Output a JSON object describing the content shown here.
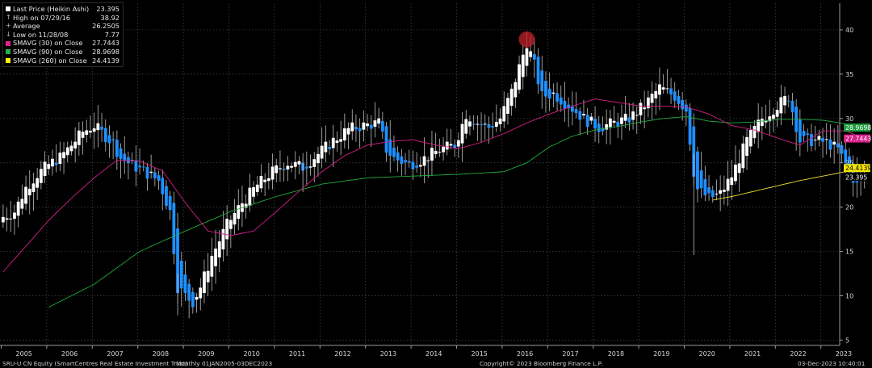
{
  "chart_data": {
    "type": "candlestick",
    "title": "SRU-U CN Equity (SmartCentres Real Estate Investment Trust)",
    "period": "Monthly 01JAN2005-03DEC2023",
    "ylim": [
      4.4,
      43
    ],
    "yticks": [
      5,
      10,
      15,
      20,
      25,
      30,
      35,
      40
    ],
    "x_year_labels": [
      "2005",
      "2006",
      "2007",
      "2008",
      "2009",
      "2010",
      "2011",
      "2012",
      "2013",
      "2014",
      "2015",
      "2016",
      "2017",
      "2018",
      "2019",
      "2020",
      "2021",
      "2022",
      "2023"
    ],
    "grid": true,
    "legend_position": "top-left",
    "candle_colors": {
      "up": "#ffffff",
      "down": "#1e90ff",
      "wick": "#bfbfbf"
    },
    "legend": [
      {
        "label": "Last Price (Heikin Ashi)",
        "value": "23.395",
        "marker": "square",
        "color": "#ffffff"
      },
      {
        "label": "High on 07/29/16",
        "value": "38.92",
        "marker": "up-arrow",
        "color": "#bbbbbb"
      },
      {
        "label": "Average",
        "value": "26.2505",
        "marker": "plus",
        "color": "#bbbbbb"
      },
      {
        "label": "Low on 11/28/08",
        "value": "7.77",
        "marker": "down-arrow",
        "color": "#bbbbbb"
      },
      {
        "label": "SMAVG (30)  on Close",
        "value": "27.7443",
        "marker": "square",
        "color": "#e0218a"
      },
      {
        "label": "SMAVG (90)  on Close",
        "value": "28.9698",
        "marker": "square",
        "color": "#22b14c"
      },
      {
        "label": "SMAVG (260)  on Close",
        "value": "24.4139",
        "marker": "square",
        "color": "#fff200"
      }
    ],
    "right_labels": [
      {
        "text": "28.9698",
        "value": 28.97,
        "bg": "#1a9a3a",
        "fg": "#ffffff"
      },
      {
        "text": "27.7443",
        "value": 27.74,
        "bg": "#d61f87",
        "fg": "#ffffff"
      },
      {
        "text": "24.4139",
        "value": 24.41,
        "bg": "#f2e600",
        "fg": "#000000"
      },
      {
        "text": "23.395",
        "value": 23.4,
        "bg": "#000000",
        "fg": "#ffffff"
      }
    ],
    "high_marker": {
      "date": "07/29/16",
      "value": 38.92
    },
    "price_close_anchors": [
      [
        "2005-01",
        18.9
      ],
      [
        "2005-04",
        19.5
      ],
      [
        "2005-07",
        22.2
      ],
      [
        "2005-10",
        23.7
      ],
      [
        "2006-01",
        24.8
      ],
      [
        "2006-04",
        25.6
      ],
      [
        "2006-07",
        27.0
      ],
      [
        "2006-10",
        28.5
      ],
      [
        "2007-01",
        29.2
      ],
      [
        "2007-03",
        28.4
      ],
      [
        "2007-06",
        27.2
      ],
      [
        "2007-08",
        25.5
      ],
      [
        "2007-12",
        24.5
      ],
      [
        "2008-03",
        23.8
      ],
      [
        "2008-06",
        23.0
      ],
      [
        "2008-09",
        19.5
      ],
      [
        "2008-11",
        11.0
      ],
      [
        "2009-01",
        10.0
      ],
      [
        "2009-03",
        9.3
      ],
      [
        "2009-05",
        11.0
      ],
      [
        "2009-08",
        14.5
      ],
      [
        "2009-12",
        18.0
      ],
      [
        "2010-04",
        20.5
      ],
      [
        "2010-08",
        22.5
      ],
      [
        "2010-12",
        24.0
      ],
      [
        "2011-04",
        25.0
      ],
      [
        "2011-08",
        24.5
      ],
      [
        "2011-12",
        26.0
      ],
      [
        "2012-04",
        27.5
      ],
      [
        "2012-08",
        28.8
      ],
      [
        "2012-12",
        29.2
      ],
      [
        "2013-04",
        29.5
      ],
      [
        "2013-06",
        26.5
      ],
      [
        "2013-08",
        25.5
      ],
      [
        "2013-12",
        24.8
      ],
      [
        "2014-04",
        25.5
      ],
      [
        "2014-08",
        26.5
      ],
      [
        "2014-12",
        27.0
      ],
      [
        "2015-03",
        30.5
      ],
      [
        "2015-06",
        29.5
      ],
      [
        "2015-09",
        29.0
      ],
      [
        "2015-12",
        30.0
      ],
      [
        "2016-03",
        33.0
      ],
      [
        "2016-07",
        38.6
      ],
      [
        "2016-09",
        36.0
      ],
      [
        "2016-11",
        32.5
      ],
      [
        "2017-02",
        32.8
      ],
      [
        "2017-06",
        31.5
      ],
      [
        "2017-10",
        30.0
      ],
      [
        "2018-02",
        29.0
      ],
      [
        "2018-06",
        29.5
      ],
      [
        "2018-10",
        30.0
      ],
      [
        "2019-02",
        31.5
      ],
      [
        "2019-06",
        33.5
      ],
      [
        "2019-10",
        32.5
      ],
      [
        "2020-01",
        31.0
      ],
      [
        "2020-03",
        24.0
      ],
      [
        "2020-04",
        22.0
      ],
      [
        "2020-07",
        21.0
      ],
      [
        "2020-10",
        21.5
      ],
      [
        "2021-01",
        23.5
      ],
      [
        "2021-05",
        27.5
      ],
      [
        "2021-09",
        30.0
      ],
      [
        "2022-01",
        31.5
      ],
      [
        "2022-04",
        32.5
      ],
      [
        "2022-07",
        27.5
      ],
      [
        "2022-11",
        27.5
      ],
      [
        "2023-02",
        27.3
      ],
      [
        "2023-05",
        26.5
      ],
      [
        "2023-08",
        24.0
      ],
      [
        "2023-10",
        22.5
      ],
      [
        "2023-12",
        23.4
      ]
    ],
    "sma30_anchors": [
      [
        "2005-01",
        12.7
      ],
      [
        "2006-01",
        18.5
      ],
      [
        "2006-07",
        21.0
      ],
      [
        "2007-01",
        23.3
      ],
      [
        "2007-07",
        25.3
      ],
      [
        "2008-01",
        25.2
      ],
      [
        "2008-07",
        24.1
      ],
      [
        "2009-01",
        20.5
      ],
      [
        "2009-07",
        17.3
      ],
      [
        "2010-01",
        16.8
      ],
      [
        "2010-07",
        17.3
      ],
      [
        "2011-01",
        19.5
      ],
      [
        "2011-07",
        21.8
      ],
      [
        "2012-01",
        24.0
      ],
      [
        "2012-07",
        25.8
      ],
      [
        "2013-01",
        27.0
      ],
      [
        "2013-07",
        27.4
      ],
      [
        "2014-01",
        27.6
      ],
      [
        "2014-07",
        27.0
      ],
      [
        "2015-01",
        26.6
      ],
      [
        "2015-07",
        27.3
      ],
      [
        "2016-01",
        28.3
      ],
      [
        "2016-07",
        29.5
      ],
      [
        "2017-01",
        30.5
      ],
      [
        "2017-07",
        31.4
      ],
      [
        "2018-01",
        32.2
      ],
      [
        "2018-07",
        31.8
      ],
      [
        "2019-01",
        31.4
      ],
      [
        "2019-07",
        31.4
      ],
      [
        "2020-01",
        31.3
      ],
      [
        "2020-07",
        30.5
      ],
      [
        "2021-01",
        29.2
      ],
      [
        "2021-07",
        28.7
      ],
      [
        "2022-01",
        27.8
      ],
      [
        "2022-07",
        27.0
      ],
      [
        "2023-01",
        28.6
      ],
      [
        "2023-07",
        28.6
      ],
      [
        "2023-12",
        27.74
      ]
    ],
    "sma90_anchors": [
      [
        "2006-01",
        8.7
      ],
      [
        "2007-01",
        11.3
      ],
      [
        "2008-01",
        15.0
      ],
      [
        "2009-01",
        17.3
      ],
      [
        "2010-01",
        19.5
      ],
      [
        "2011-01",
        21.2
      ],
      [
        "2012-01",
        22.6
      ],
      [
        "2013-01",
        23.3
      ],
      [
        "2014-01",
        23.5
      ],
      [
        "2015-01",
        23.7
      ],
      [
        "2016-01",
        24.0
      ],
      [
        "2016-07",
        25.0
      ],
      [
        "2017-01",
        26.8
      ],
      [
        "2017-07",
        28.0
      ],
      [
        "2018-01",
        28.7
      ],
      [
        "2018-07",
        29.1
      ],
      [
        "2019-01",
        29.6
      ],
      [
        "2019-07",
        30.0
      ],
      [
        "2020-01",
        30.2
      ],
      [
        "2020-07",
        29.7
      ],
      [
        "2021-01",
        29.5
      ],
      [
        "2021-07",
        29.6
      ],
      [
        "2022-01",
        29.9
      ],
      [
        "2022-07",
        29.9
      ],
      [
        "2023-01",
        29.8
      ],
      [
        "2023-07",
        29.4
      ],
      [
        "2023-12",
        28.97
      ]
    ],
    "sma260_anchors": [
      [
        "2020-08",
        20.8
      ],
      [
        "2021-01",
        21.2
      ],
      [
        "2021-07",
        21.8
      ],
      [
        "2022-01",
        22.4
      ],
      [
        "2022-07",
        23.0
      ],
      [
        "2023-01",
        23.5
      ],
      [
        "2023-07",
        24.0
      ],
      [
        "2023-12",
        24.41
      ]
    ]
  },
  "footer": {
    "security": "SRU-U CN Equity (SmartCentres Real Estate Investment Trust)",
    "range": "Monthly 01JAN2005-03DEC2023",
    "copyright": "Copyright© 2023 Bloomberg Finance L.P.",
    "timestamp": "03-Dec-2023 10:40:01"
  }
}
